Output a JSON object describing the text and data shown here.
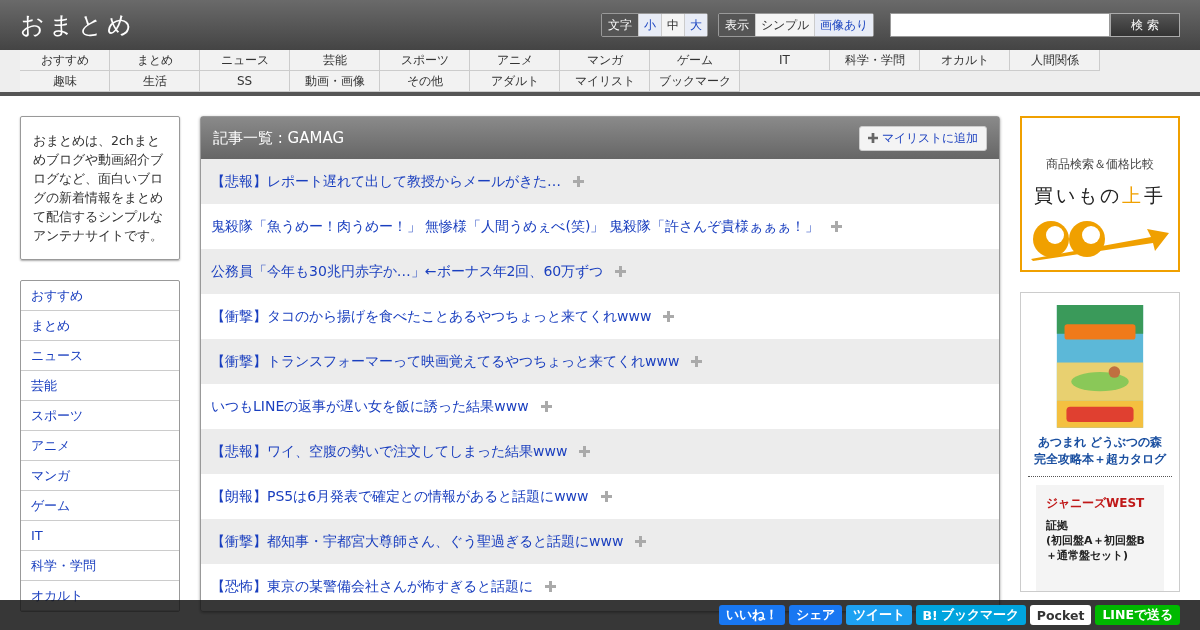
{
  "header": {
    "logo": "おまとめ",
    "font_size": {
      "label": "文字",
      "options": [
        {
          "label": "小",
          "selected": false
        },
        {
          "label": "中",
          "selected": true
        },
        {
          "label": "大",
          "selected": false
        }
      ]
    },
    "display": {
      "label": "表示",
      "options": [
        {
          "label": "シンプル",
          "selected": true
        },
        {
          "label": "画像あり",
          "selected": false
        }
      ]
    },
    "search_button": "検 索"
  },
  "nav": [
    [
      "おすすめ",
      "まとめ",
      "ニュース",
      "芸能",
      "スポーツ",
      "アニメ",
      "マンガ",
      "ゲーム",
      "IT",
      "科学・学問",
      "オカルト",
      "人間関係"
    ],
    [
      "趣味",
      "生活",
      "SS",
      "動画・画像",
      "その他",
      "アダルト",
      "マイリスト",
      "ブックマーク"
    ]
  ],
  "about": "おまとめは、2chまとめブログや動画紹介ブログなど、面白いブログの新着情報をまとめて配信するシンプルなアンテナサイトです。",
  "sidebar": {
    "items": [
      "おすすめ",
      "まとめ",
      "ニュース",
      "芸能",
      "スポーツ",
      "アニメ",
      "マンガ",
      "ゲーム",
      "IT",
      "科学・学問",
      "オカルト"
    ]
  },
  "articles": {
    "title": "記事一覧 : GAMAG",
    "add_button": "マイリストに追加",
    "items": [
      "【悲報】レポート遅れて出して教授からメールがきた…",
      "鬼殺隊「魚うめー！肉うめー！」 無惨様「人間うめぇべ(笑)」 鬼殺隊「許さんぞ貴様ぁぁぁ！」",
      "公務員「今年も30兆円赤字か…」←ボーナス年2回、60万ずつ",
      "【衝撃】タコのから揚げを食べたことあるやつちょっと来てくれwww",
      "【衝撃】トランスフォーマーって映画覚えてるやつちょっと来てくれwww",
      "いつもLINEの返事が遅い女を飯に誘った結果www",
      "【悲報】ワイ、空腹の勢いで注文してしまった結果www",
      "【朗報】PS5は6月発表で確定との情報があると話題にwww",
      "【衝撃】都知事・宇都宮大尊師さん、ぐう聖過ぎると話題にwww",
      "【恐怖】東京の某警備会社さんが怖すぎると話題に"
    ]
  },
  "ads": {
    "banner": {
      "subtitle": "商品検索＆価格比較",
      "title_parts": [
        "買いもの",
        "上",
        "手"
      ]
    },
    "book": {
      "kind": "picture",
      "caption_lines": [
        "あつまれ どうぶつの森",
        "完全攻略本＋超カタログ"
      ]
    },
    "cd": {
      "artist": "ジャニーズWEST",
      "title": "証拠\n(初回盤A＋初回盤B\n＋通常盤セット)"
    }
  },
  "share_bar": [
    {
      "kind": "like",
      "label": "いいね！"
    },
    {
      "kind": "share",
      "label": "シェア"
    },
    {
      "kind": "tweet",
      "label": "ツイート"
    },
    {
      "kind": "hatena",
      "label": "ブックマーク",
      "prefix": "B!"
    },
    {
      "kind": "pocket",
      "label": "Pocket"
    },
    {
      "kind": "line",
      "label": "LINEで送る"
    }
  ]
}
